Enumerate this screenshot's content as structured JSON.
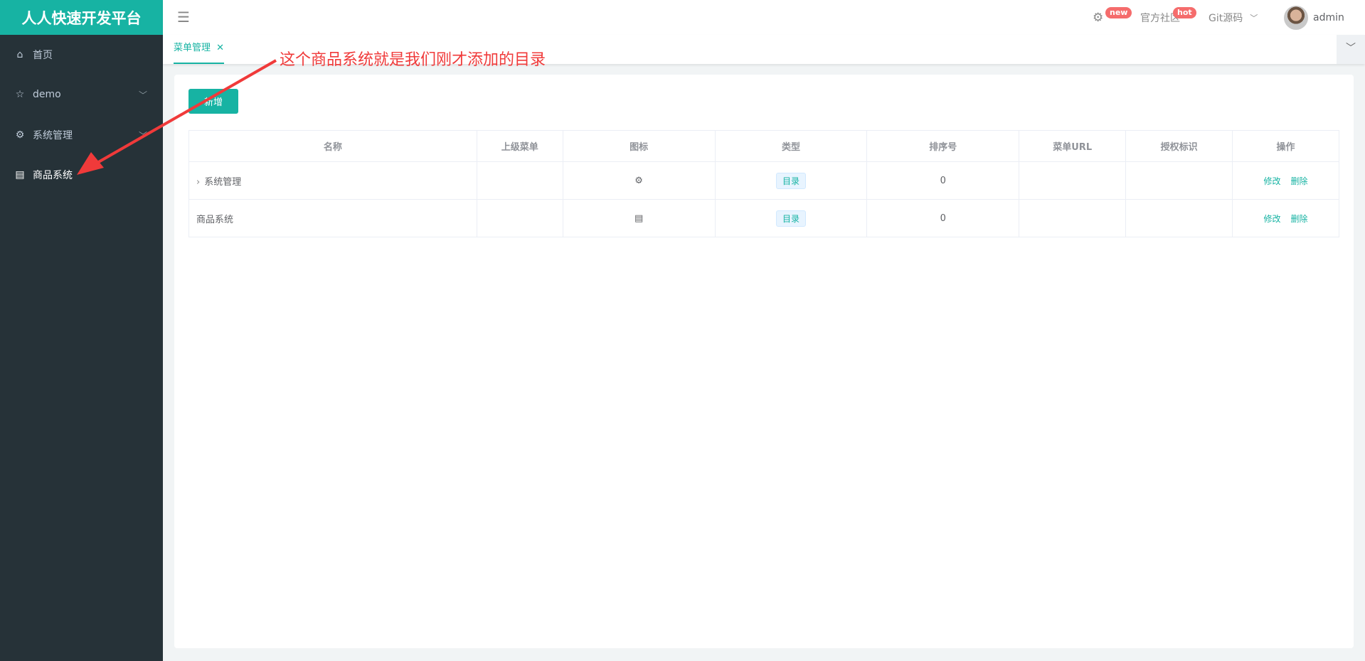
{
  "app": {
    "title": "人人快速开发平台"
  },
  "sidebar": {
    "items": [
      {
        "label": "首页",
        "icon": "home-icon"
      },
      {
        "label": "demo",
        "icon": "star-icon"
      },
      {
        "label": "系统管理",
        "icon": "gear-icon"
      },
      {
        "label": "商品系统",
        "icon": "document-icon"
      }
    ]
  },
  "header": {
    "badge_new": "new",
    "community": "官方社区",
    "badge_hot": "hot",
    "git": "Git源码",
    "user": "admin"
  },
  "tabs": [
    {
      "label": "菜单管理",
      "close": "✕"
    }
  ],
  "main": {
    "add_label": "新增",
    "columns": [
      "名称",
      "上级菜单",
      "图标",
      "类型",
      "排序号",
      "菜单URL",
      "授权标识",
      "操作"
    ],
    "rows": [
      {
        "name": "系统管理",
        "parent": "",
        "icon": "gear-icon",
        "type": "目录",
        "order": "0",
        "url": "",
        "perms": "",
        "edit": "修改",
        "delete": "删除"
      },
      {
        "name": "商品系统",
        "parent": "",
        "icon": "document-icon",
        "type": "目录",
        "order": "0",
        "url": "",
        "perms": "",
        "edit": "修改",
        "delete": "删除"
      }
    ]
  },
  "annotation": {
    "text": "这个商品系统就是我们刚才添加的目录",
    "color": "#f03a3a"
  },
  "colors": {
    "accent": "#17b3a3",
    "sidebar": "#263238"
  }
}
